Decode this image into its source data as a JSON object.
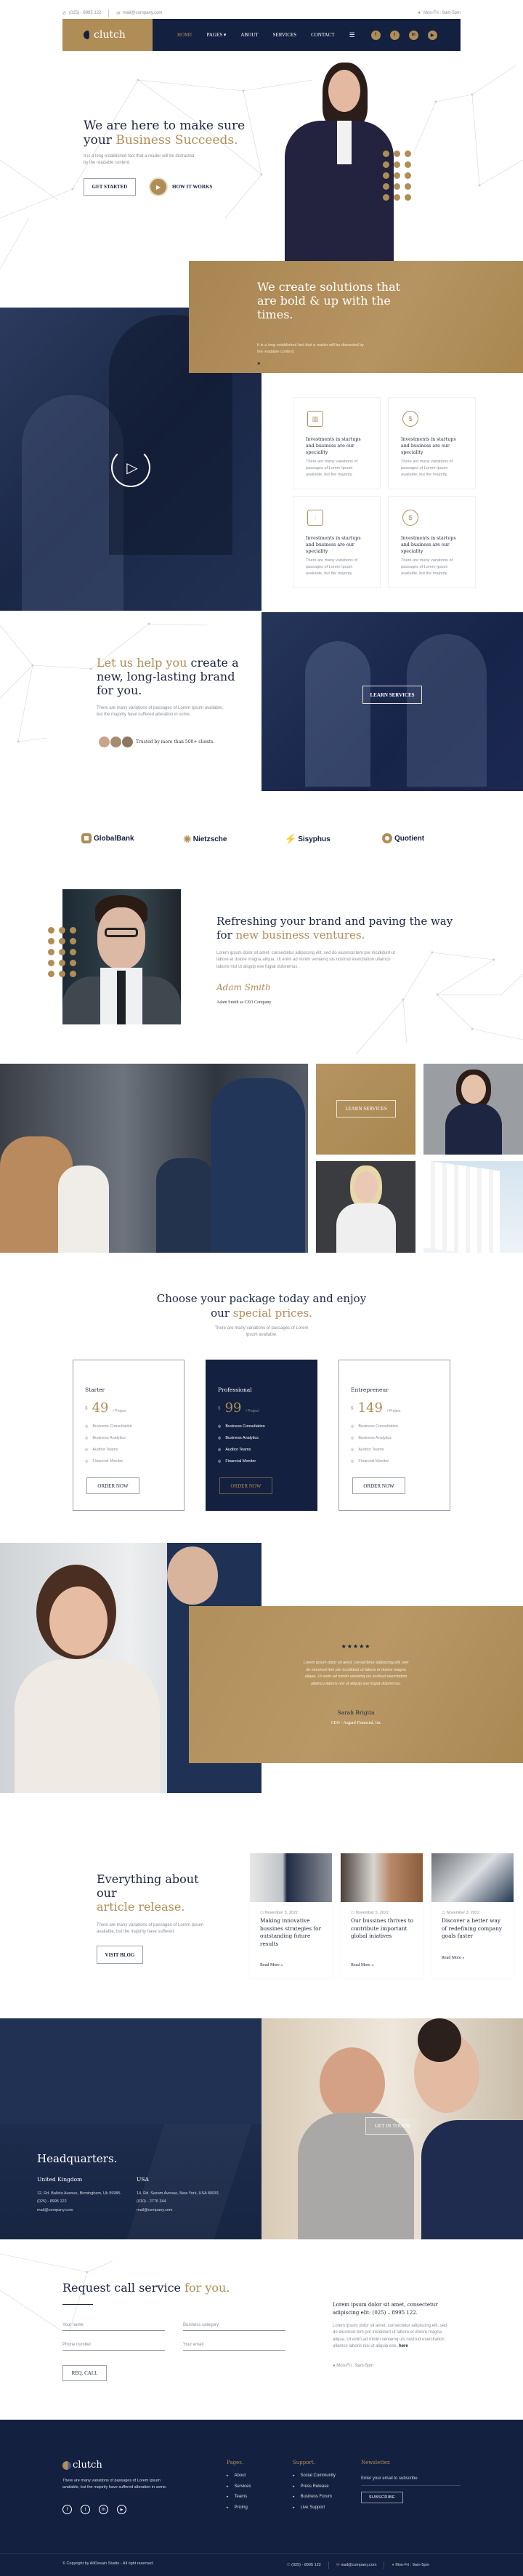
{
  "colors": {
    "navy": "#13203f",
    "gold": "#b08d57",
    "text": "#1b2541"
  },
  "topbar": {
    "phone": "(025) - 8995 122",
    "email": "mail@company.com",
    "hours": "Mon-Fri : 9am-5pm",
    "phone_icon": "phone-icon",
    "email_icon": "envelope-icon",
    "clock_icon": "clock-icon"
  },
  "nav": {
    "logo": "clutch",
    "items": [
      "HOME",
      "PAGES",
      "ABOUT",
      "SERVICES",
      "CONTACT"
    ],
    "social": [
      "facebook",
      "twitter",
      "linkedin",
      "youtube"
    ]
  },
  "hero": {
    "title_a": "We are here to make sure",
    "title_b": "your ",
    "title_gold": "Business Succeeds.",
    "text": "It is a long established fact that a reader will be distracted by the readable content.",
    "cta": "GET STARTED",
    "video_label": "HOW IT WORKS"
  },
  "solutions": {
    "title": "We create solutions that are bold & up with the times.",
    "text": "It is a long established fact that a reader will be distracted by the readable content.",
    "arrow": "»"
  },
  "features": [
    {
      "icon": "chart-growth-icon",
      "title": "Investments in startups and business are our speciality",
      "text": "There are many variations of passages of Lorem Ipsum available, but the majority."
    },
    {
      "icon": "money-exchange-icon",
      "title": "Investments in startups and business are our speciality",
      "text": "There are many variations of passages of Lorem Ipsum available, but the majority."
    },
    {
      "icon": "candlestick-icon",
      "title": "Investments in startups and business are our speciality",
      "text": "There are many variations of passages of Lorem Ipsum available, but the majority."
    },
    {
      "icon": "money-cycle-icon",
      "title": "Investments in startups and business are our speciality",
      "text": "There are many variations of passages of Lorem Ipsum available, but the majority."
    }
  ],
  "brand": {
    "title_gold": "Let us help you",
    "title_rest": " create a new, long-lasting brand for you.",
    "text": "There are many variations of passages of Lorem Ipsum available, but the majority have suffered alteration in some.",
    "trusted": "Trusted by more than 500+ clients.",
    "button": "LEARN SERVICES"
  },
  "logos": [
    "GlobalBank",
    "Nietzsche",
    "Sisyphus",
    "Quotient"
  ],
  "about": {
    "title_a": "Refreshing your brand and paving the way for ",
    "title_gold": "new business ventures.",
    "text": "Lorem ipsum dolor sit amet, consectetur adipiscing elit, sed do eiusmod tem por incididunt ut labore et dolore magna aliqua. Ut enim ad minim veniamq uis nostrud exercitation ullamco laboris nisl ut aliquip ese fugiat doloremus.",
    "signature": "Adam Smith",
    "caption": "Adam Smith as CEO Company"
  },
  "gallery": {
    "button": "LEARN SERVICES"
  },
  "pricing": {
    "title_a": "Choose your package today and enjoy our ",
    "title_gold": "special prices.",
    "subtitle": "There are many variations of passages of Lorem Ipsum available.",
    "plans": [
      {
        "name": "Starter",
        "currency": "$",
        "price": "49",
        "unit": "/ Project",
        "features": [
          "Business Consultation",
          "Business Analytics",
          "Auditor Teams",
          "Financial Monitor"
        ],
        "button": "ORDER NOW",
        "featured": false
      },
      {
        "name": "Professional",
        "currency": "$",
        "price": "99",
        "unit": "/ Project",
        "features": [
          "Business Consultation",
          "Business Analytics",
          "Auditor Teams",
          "Financial Monitor"
        ],
        "button": "ORDER NOW",
        "featured": true
      },
      {
        "name": "Entrepreneur",
        "currency": "$",
        "price": "149",
        "unit": "/ Project",
        "features": [
          "Business Consultation",
          "Business Analytics",
          "Auditor Teams",
          "Financial Monitor"
        ],
        "button": "ORDER NOW",
        "featured": false
      }
    ]
  },
  "testimonial": {
    "rating": 5,
    "stars": "★★★★★",
    "quote": "Lorem ipsum dolor sit amet, consectetur adipiscing elit, sed do eiusmod tem por incididunt ut labore et dolore magna aliqua. Ut enim ad minim veniamq uis nostrud exercitation ullamco laboris nisi ut aliquip ese fugiat doloremus.",
    "name": "Sarah Brigita",
    "role": "CEO - Asgard Financial, Inc"
  },
  "blog": {
    "title_a": "Everything about our",
    "title_gold": "article release.",
    "text": "There are many variations of passages of Lorem Ipsum available, but the majority have suffered.",
    "button": "VISIT BLOG",
    "posts": [
      {
        "date": "November 5, 2022",
        "title": "Making innovative bussines strategies for outstanding future results",
        "more": "Read More »"
      },
      {
        "date": "November 5, 2022",
        "title": "Our bussines thrives to contribute important global iniatives",
        "more": "Read More »"
      },
      {
        "date": "November 3, 2022",
        "title": "Discover a better way of redefining company goals faster",
        "more": "Read More »"
      }
    ]
  },
  "hq": {
    "title": "Headquarters.",
    "button": "GET IN TOUCH",
    "offices": [
      {
        "name": "United Kingdom",
        "address": "12, Rd. Balista Avenue, Birmingham, Uk 59985",
        "phone": "(025) - 8995 122",
        "email": "mail@company.com"
      },
      {
        "name": "USA",
        "address": "14, Rd. Sazam Avenue, New York, USA 80081",
        "phone": "(010) - 2776 344",
        "email": "mail@company.com"
      }
    ]
  },
  "contact": {
    "title_a": "Request call service ",
    "title_gold": "for you.",
    "fields": {
      "name": "Your name",
      "category": "Business category",
      "phone": "Phone number",
      "email": "Your email"
    },
    "button": "REQ. CALL",
    "info_title": "Lorem ipsum dolor sit amet, consectetur adipiscing elit: (025) – 8995 122.",
    "info_text": "Lorem ipsum dolor sit amet, consectetur adipiscing elit, sed do eiusmod tem por incididunt ut labore et dolore magna aliqua. Ut enim ad minim veniamq uis nostrud exercitation ullamco laboris nisi ut aliquip ese, ",
    "info_link": "here",
    "hours": "Mon-Fri : 9am-5pm"
  },
  "footer": {
    "logo": "clutch",
    "text": "There are many variations of passages of Lorem Ipsum available, but the majority have suffered alteration in some.",
    "pages_title": "Pages.",
    "pages": [
      "About",
      "Services",
      "Teams",
      "Pricing"
    ],
    "support_title": "Support.",
    "support": [
      "Social Community",
      "Press Release",
      "Business Forum",
      "Live Support"
    ],
    "newsletter_title": "Newsletter.",
    "newsletter_placeholder": "Enter your email to subscribe",
    "subscribe": "SUBSCRIBE",
    "copyright": "© Copyright by AltDesain Studio - All right reserved.",
    "phone": "(025) - 8995 122",
    "email": "mail@company.com",
    "hours": "Mon-Fri : 9am-5pm"
  }
}
